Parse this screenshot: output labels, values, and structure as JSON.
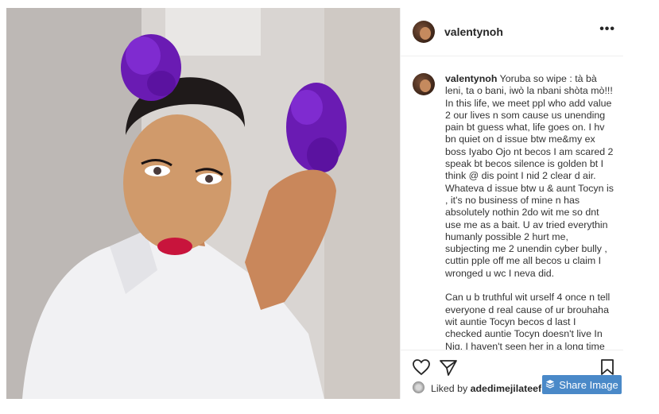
{
  "post": {
    "username": "valentynoh",
    "more_label": "•••",
    "caption_user": "valentynoh",
    "caption_text": " Yoruba so wipe : tà bà leni, ta o bani, iwò la nbani shòta mò!!!\nIn this life, we meet ppl who add value 2 our lives n som cause us unending pain bt guess what, life goes on. I hv bn quiet on d issue btw me&my ex boss Iyabo Ojo nt becos I am scared 2 speak bt becos silence is golden bt I think @ dis point I nid 2 clear d air. Whateva d issue btw u & aunt Tocyn is , it's no business of mine n has absolutely nothin 2do wit me so dnt use me as a bait. U av tried everythin humanly possible 2 hurt me, subjecting me 2 unendin cyber bully , cuttin pple off me all becos u claim I wronged u wc I neva did.\n\nCan u b truthful wit urself 4 once n tell everyone d real cause of ur brouhaha wit auntie Tocyn becos d last I checked auntie Tocyn doesn't live In Nig. I haven't seen her in a long time neither",
    "liked_prefix": "Liked by ",
    "liked_user": "adedimejilateef",
    "liked_suffix": " a"
  },
  "share_button": {
    "label": "Share Image",
    "icon": "layers-icon"
  },
  "icons": {
    "like": "heart-icon",
    "share": "send-icon",
    "save": "bookmark-icon"
  },
  "colors": {
    "share_bg": "#4a89c8",
    "hair_accent": "#6a1bb3",
    "lip": "#c8143c"
  }
}
